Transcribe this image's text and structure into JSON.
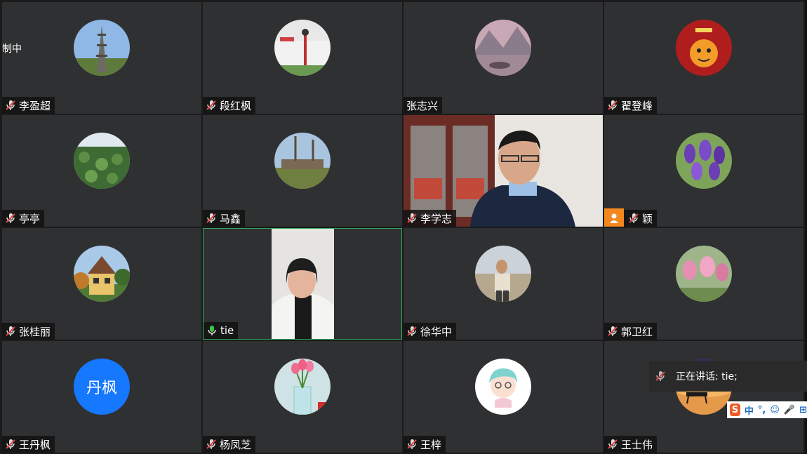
{
  "status_left": "制中",
  "speaking": {
    "label": "正在讲话: tie;"
  },
  "ime": {
    "items": [
      "中",
      "°,",
      "☺",
      "🎤",
      "⊞"
    ]
  },
  "tiles": [
    {
      "name": "李盈超",
      "muted": true
    },
    {
      "name": "段红枫",
      "muted": true
    },
    {
      "name": "张志兴",
      "muted": false,
      "no_icon": true
    },
    {
      "name": "翟登峰",
      "muted": true
    },
    {
      "name": "亭亭",
      "muted": true
    },
    {
      "name": "马鑫",
      "muted": true
    },
    {
      "name": "李学志",
      "muted": true
    },
    {
      "name": "颖",
      "muted": true,
      "user_badge": true
    },
    {
      "name": "张桂丽",
      "muted": true
    },
    {
      "name": "tie",
      "muted": false,
      "active": true
    },
    {
      "name": "徐华中",
      "muted": true
    },
    {
      "name": "郭卫红",
      "muted": true
    },
    {
      "name": "王丹枫",
      "muted": true,
      "initials": "丹枫"
    },
    {
      "name": "杨凤芝",
      "muted": true
    },
    {
      "name": "王梓",
      "muted": true
    },
    {
      "name": "王士伟",
      "muted": true
    }
  ],
  "colors": {
    "accent": "#2ea85b",
    "tile_bg": "#2f3031",
    "initials_bg": "#1677ff",
    "user_badge": "#f2871d"
  }
}
